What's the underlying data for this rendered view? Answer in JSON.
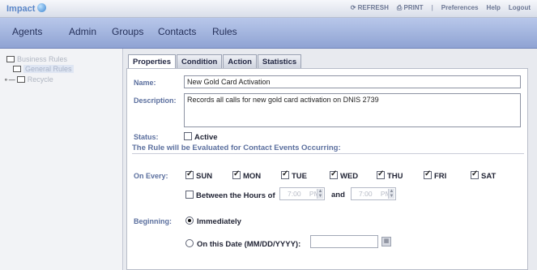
{
  "app": {
    "title": "Impact"
  },
  "toplinks": {
    "refresh": "REFRESH",
    "print": "PRINT",
    "preferences": "Preferences",
    "help": "Help",
    "logout": "Logout"
  },
  "nav": {
    "agents": "Agents",
    "admin": "Admin",
    "groups": "Groups",
    "contacts": "Contacts",
    "rules": "Rules"
  },
  "tree": {
    "root": "Business Rules",
    "child": "General Rules",
    "recycle": "Recycle"
  },
  "tabs": [
    "Properties",
    "Condition",
    "Action",
    "Statistics"
  ],
  "form": {
    "name_label": "Name:",
    "name_value": "New Gold Card Activation",
    "description_label": "Description:",
    "description_value": "Records all calls for new gold card activation on DNIS 2739",
    "status_label": "Status:",
    "active_label": "Active",
    "evaluated_text": "The Rule will be Evaluated for Contact Events Occurring:",
    "on_every_label": "On Every:",
    "days": [
      "SUN",
      "MON",
      "TUE",
      "WED",
      "THU",
      "FRI",
      "SAT"
    ],
    "between_label": "Between the Hours of",
    "start_time": "7:00",
    "start_ampm": "PM",
    "and_label": "and",
    "end_time": "7:00",
    "end_ampm": "PM",
    "beginning_label": "Beginning:",
    "immediately_label": "Immediately",
    "on_date_label": "On this Date (MM/DD/YYYY):"
  }
}
